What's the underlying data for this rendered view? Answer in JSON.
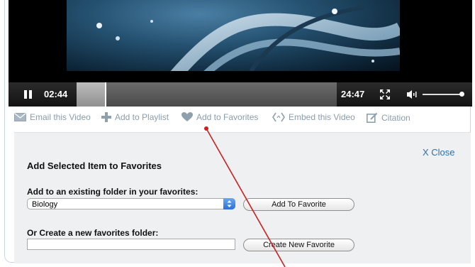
{
  "player": {
    "current_time": "02:44",
    "duration": "24:47",
    "progress_fraction": 0.11,
    "volume_fraction": 1.0
  },
  "actions": [
    {
      "label": "Email this Video",
      "icon": "envelope-icon"
    },
    {
      "label": "Add to Playlist",
      "icon": "plus-icon"
    },
    {
      "label": "Add to Favorites",
      "icon": "heart-icon"
    },
    {
      "label": "Embed this Video",
      "icon": "embed-icon"
    },
    {
      "label": "Citation",
      "icon": "citation-icon"
    }
  ],
  "favorites_panel": {
    "title": "Add Selected Item to Favorites",
    "close_label": "X Close",
    "existing_label": "Add to an existing folder in your favorites:",
    "selected_folder": "Biology",
    "add_button": "Add To Favorite",
    "new_label": "Or Create a new favorites folder:",
    "new_folder_value": "",
    "create_button": "Create New Favorite"
  },
  "colors": {
    "accent": "#2f6fa8",
    "action_text": "#8a9cab",
    "panel_bg": "#eef0f2",
    "annotation": "#cc1f1f"
  }
}
